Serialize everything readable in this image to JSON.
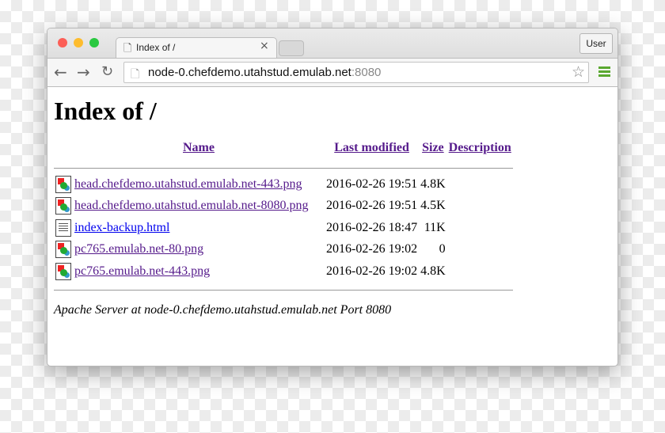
{
  "browser": {
    "tab_title": "Index of /",
    "user_button": "User",
    "url_host": "node-0.chefdemo.utahstud.emulab.net",
    "url_port": ":8080"
  },
  "page": {
    "title": "Index of /",
    "columns": [
      "Name",
      "Last modified",
      "Size",
      "Description"
    ],
    "rows": [
      {
        "name": "head.chefdemo.utahstud.emulab.net-443.png",
        "modified": "2016-02-26 19:51",
        "size": "4.8K",
        "description": "",
        "icon": "image-icon",
        "visited": true
      },
      {
        "name": "head.chefdemo.utahstud.emulab.net-8080.png",
        "modified": "2016-02-26 19:51",
        "size": "4.5K",
        "description": "",
        "icon": "image-icon",
        "visited": true
      },
      {
        "name": "index-backup.html",
        "modified": "2016-02-26 18:47",
        "size": "11K",
        "description": "",
        "icon": "text-file-icon",
        "visited": false
      },
      {
        "name": "pc765.emulab.net-80.png",
        "modified": "2016-02-26 19:02",
        "size": "0",
        "description": "",
        "icon": "image-icon",
        "visited": true
      },
      {
        "name": "pc765.emulab.net-443.png",
        "modified": "2016-02-26 19:02",
        "size": "4.8K",
        "description": "",
        "icon": "image-icon",
        "visited": true
      }
    ],
    "footer": "Apache Server at node-0.chefdemo.utahstud.emulab.net Port 8080"
  },
  "colors": {
    "visited_link": "#551a8b",
    "link": "#0000ee",
    "menu_accent": "#5aa830"
  }
}
